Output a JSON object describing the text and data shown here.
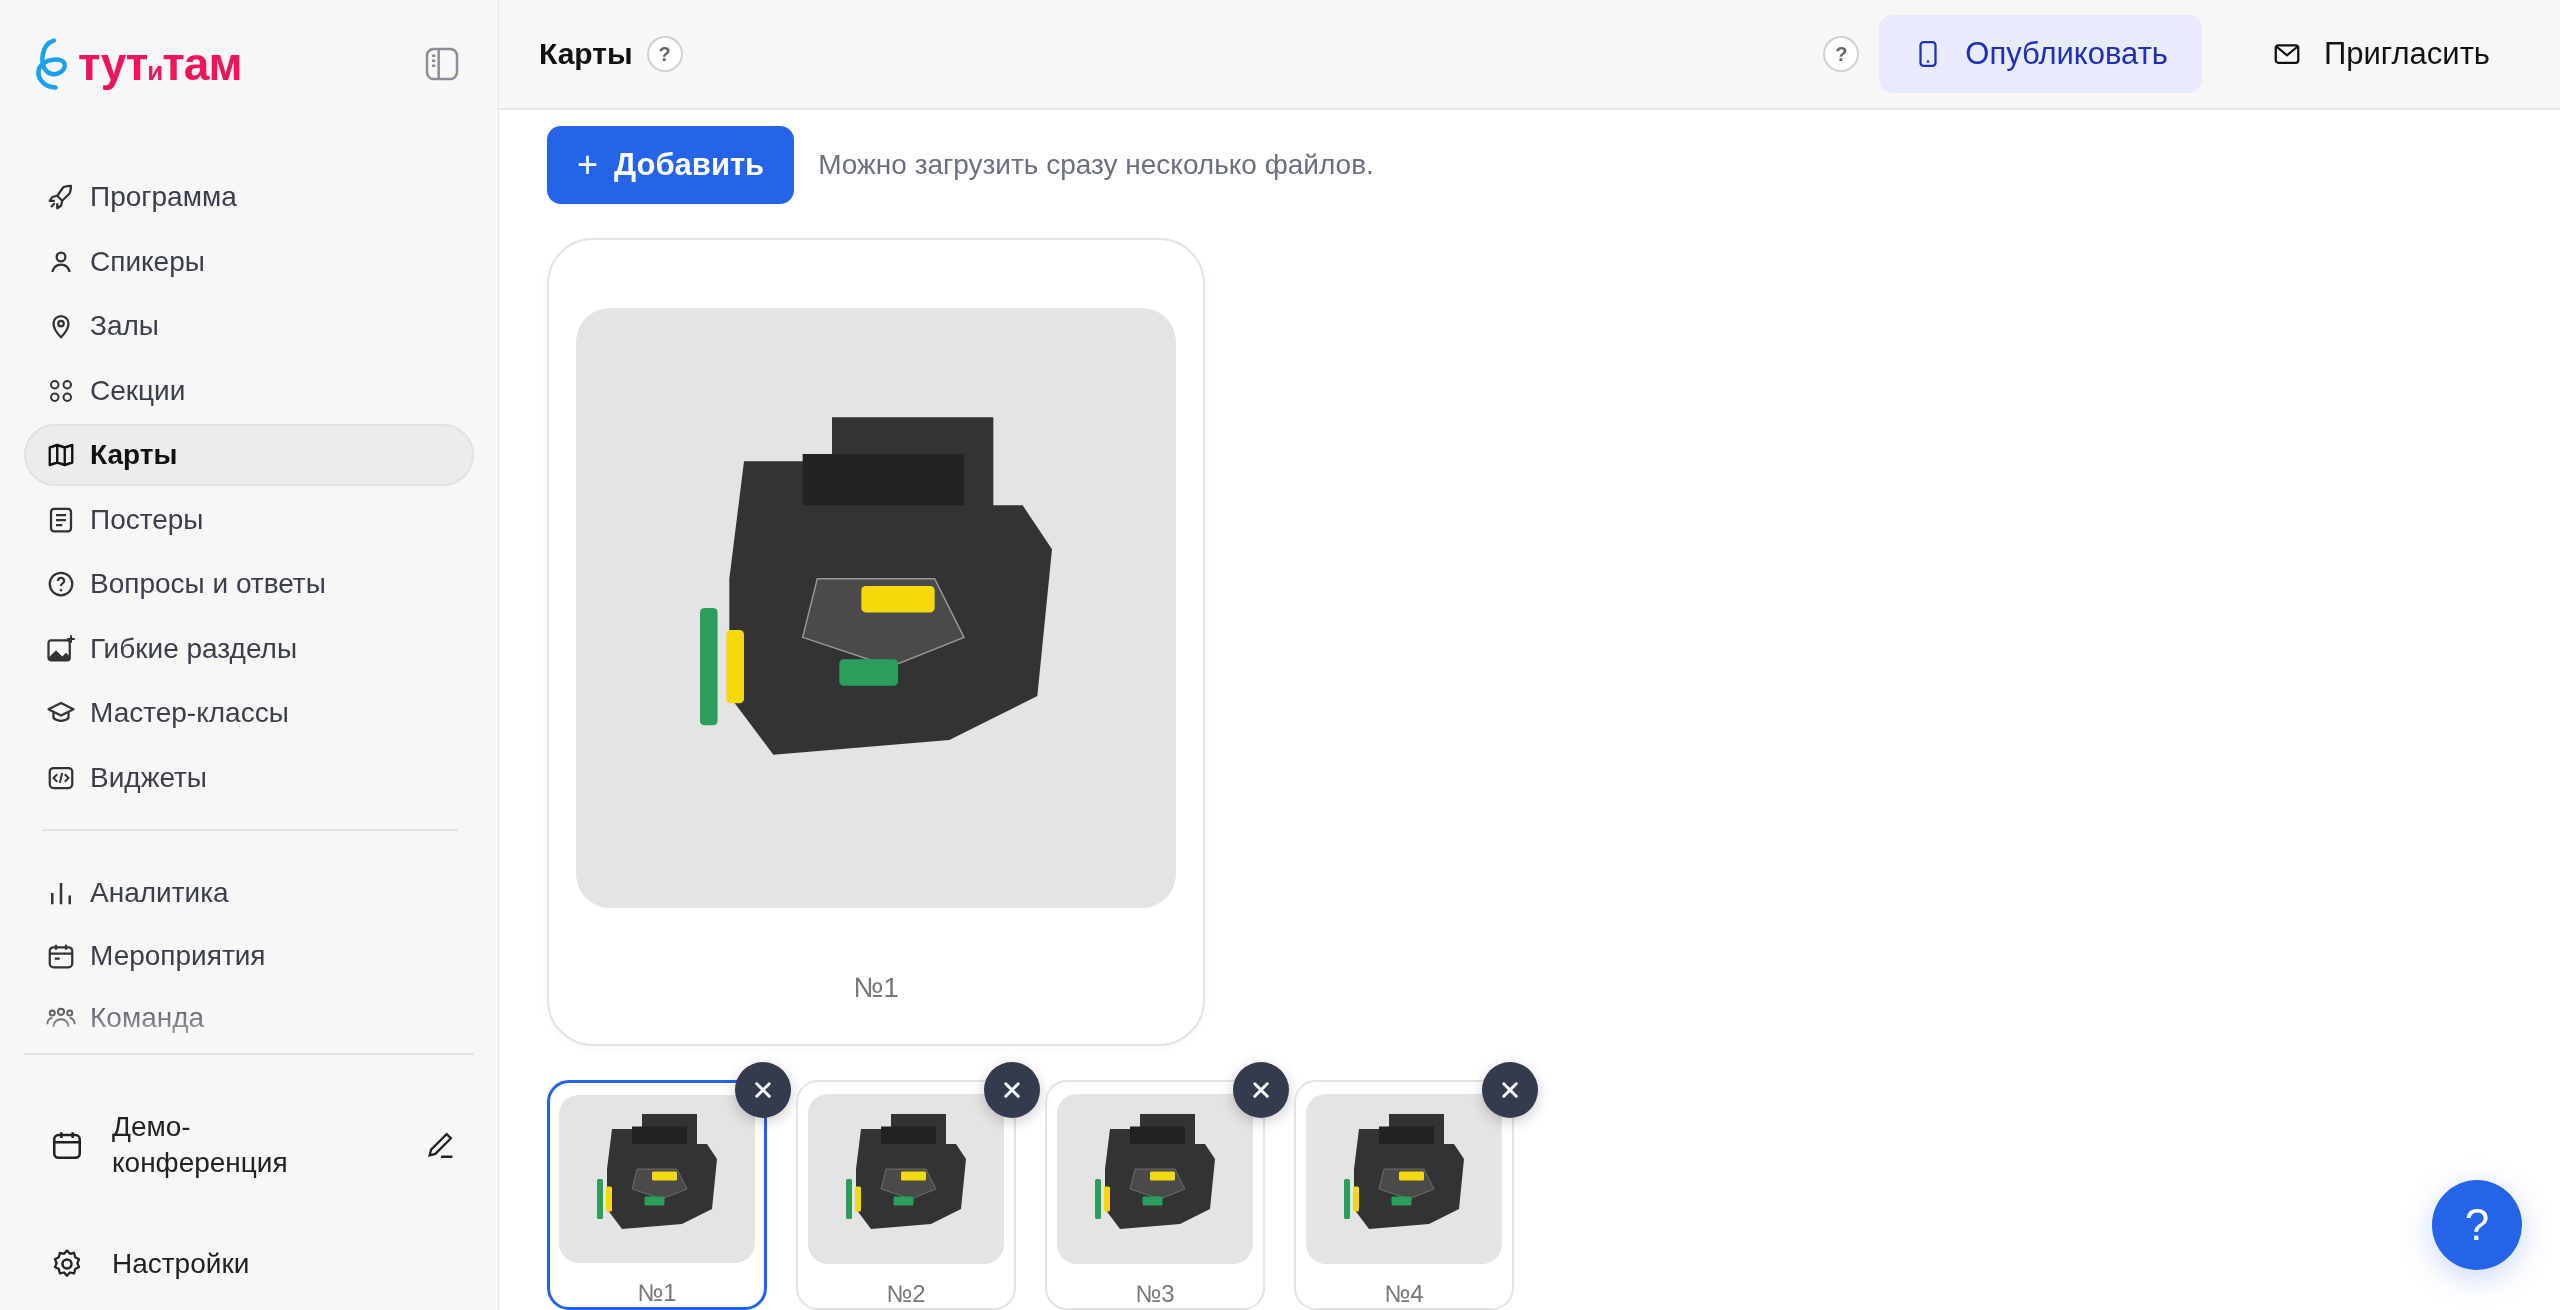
{
  "sidebar": {
    "logo": "тут$_{и}$там",
    "items": [
      {
        "label": "Программа",
        "selected": false
      },
      {
        "label": "Спикеры",
        "selected": false
      },
      {
        "label": "Залы",
        "selected": false
      },
      {
        "label": "Секции",
        "selected": false
      },
      {
        "label": "Карты",
        "selected": true
      },
      {
        "label": "Постеры",
        "selected": false
      },
      {
        "label": "Вопросы и ответы",
        "selected": false
      },
      {
        "label": "Гибкие разделы",
        "selected": false
      },
      {
        "label": "Мастер-классы",
        "selected": false
      },
      {
        "label": "Виджеты",
        "selected": false
      }
    ],
    "items_secondary": [
      {
        "label": "Аналитика",
        "selected": false
      },
      {
        "label": "Мероприятия",
        "selected": false
      },
      {
        "label": "Команда",
        "selected": false
      }
    ],
    "event": {
      "label": "Демо-конференция"
    },
    "settings": {
      "label": "Настройки"
    }
  },
  "header": {
    "title": "Карты",
    "title_help": "?",
    "help": "?",
    "publish": "Опубликовать",
    "invite": "Пригласить"
  },
  "toolbar": {
    "add": "Добавить",
    "add_icon": "+",
    "hint": "Можно загрузить сразу несколько файлов."
  },
  "preview": {
    "label": "№1"
  },
  "thumbnails": [
    {
      "label": "№1",
      "selected": true
    },
    {
      "label": "№2",
      "selected": false
    },
    {
      "label": "№3",
      "selected": false
    },
    {
      "label": "№4",
      "selected": false
    }
  ],
  "help_fab": "?"
}
